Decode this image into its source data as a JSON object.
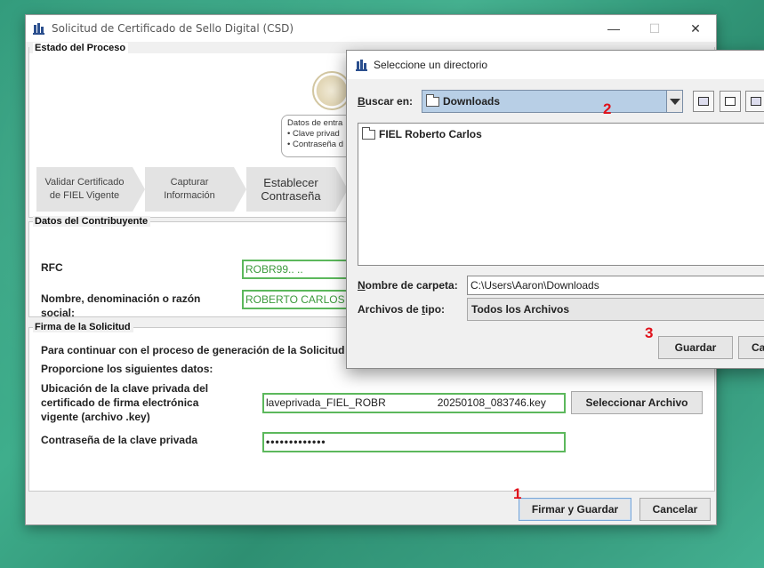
{
  "main_window": {
    "title": "Solicitud de Certificado de Sello Digital (CSD)",
    "controls": {
      "minimize": "—",
      "maximize": "☐",
      "close": "✕"
    }
  },
  "estado": {
    "title": "Estado del Proceso",
    "datos_box": [
      "Datos de entra",
      "• Clave privad",
      "• Contraseña d"
    ],
    "steps": [
      {
        "line1": "Validar Certificado",
        "line2": "de FIEL Vigente"
      },
      {
        "line1": "Capturar",
        "line2": "Información"
      },
      {
        "line1": "Establecer",
        "line2": "Contraseña"
      }
    ]
  },
  "contribuyente": {
    "title": "Datos del Contribuyente",
    "rfc_label": "RFC",
    "rfc_value": "ROBR99..  ..",
    "nombre_label_1": "Nombre, denominación o razón",
    "nombre_label_2": "social:",
    "nombre_value": "ROBERTO CARLOS R"
  },
  "firma": {
    "title": "Firma de la Solicitud",
    "continuar_text": "Para continuar con el proceso de generación de la Solicitud d",
    "proporcione_text": "Proporcione los siguientes datos:",
    "ubicacion_label_1": "Ubicación de la clave privada del",
    "ubicacion_label_2": "certificado de firma electrónica",
    "ubicacion_label_3": "vigente (archivo .key)",
    "key_value_left": "laveprivada_FIEL_ROBR",
    "key_value_right": "20250108_083746.key",
    "seleccionar_label": "Seleccionar Archivo",
    "contrasena_label": "Contraseña de la clave privada",
    "contrasena_value": "•••••••••••••"
  },
  "footer": {
    "firmar_label": "Firmar y Guardar",
    "cancelar_label": "Cancelar"
  },
  "dialog": {
    "title": "Seleccione un directorio",
    "buscar_label_pre": "B",
    "buscar_label_rest": "uscar en:",
    "buscar_value": "Downloads",
    "files": [
      {
        "name": "FIEL Roberto Carlos"
      }
    ],
    "nombre_label_pre": "N",
    "nombre_label_rest": "ombre de carpeta:",
    "nombre_value": "C:\\Users\\Aaron\\Downloads",
    "tipo_label_pre": "Archivos de ",
    "tipo_label_mn": "t",
    "tipo_label_rest": "ipo:",
    "tipo_value": "Todos los Archivos",
    "guardar_label": "Guardar",
    "cancel_partial": "Ca"
  },
  "annotations": {
    "one": "1",
    "two": "2",
    "three": "3"
  },
  "colors": {
    "field_border": "#5cb85c",
    "annotation": "#e0101a",
    "combo_bg": "#b8cfe6"
  }
}
